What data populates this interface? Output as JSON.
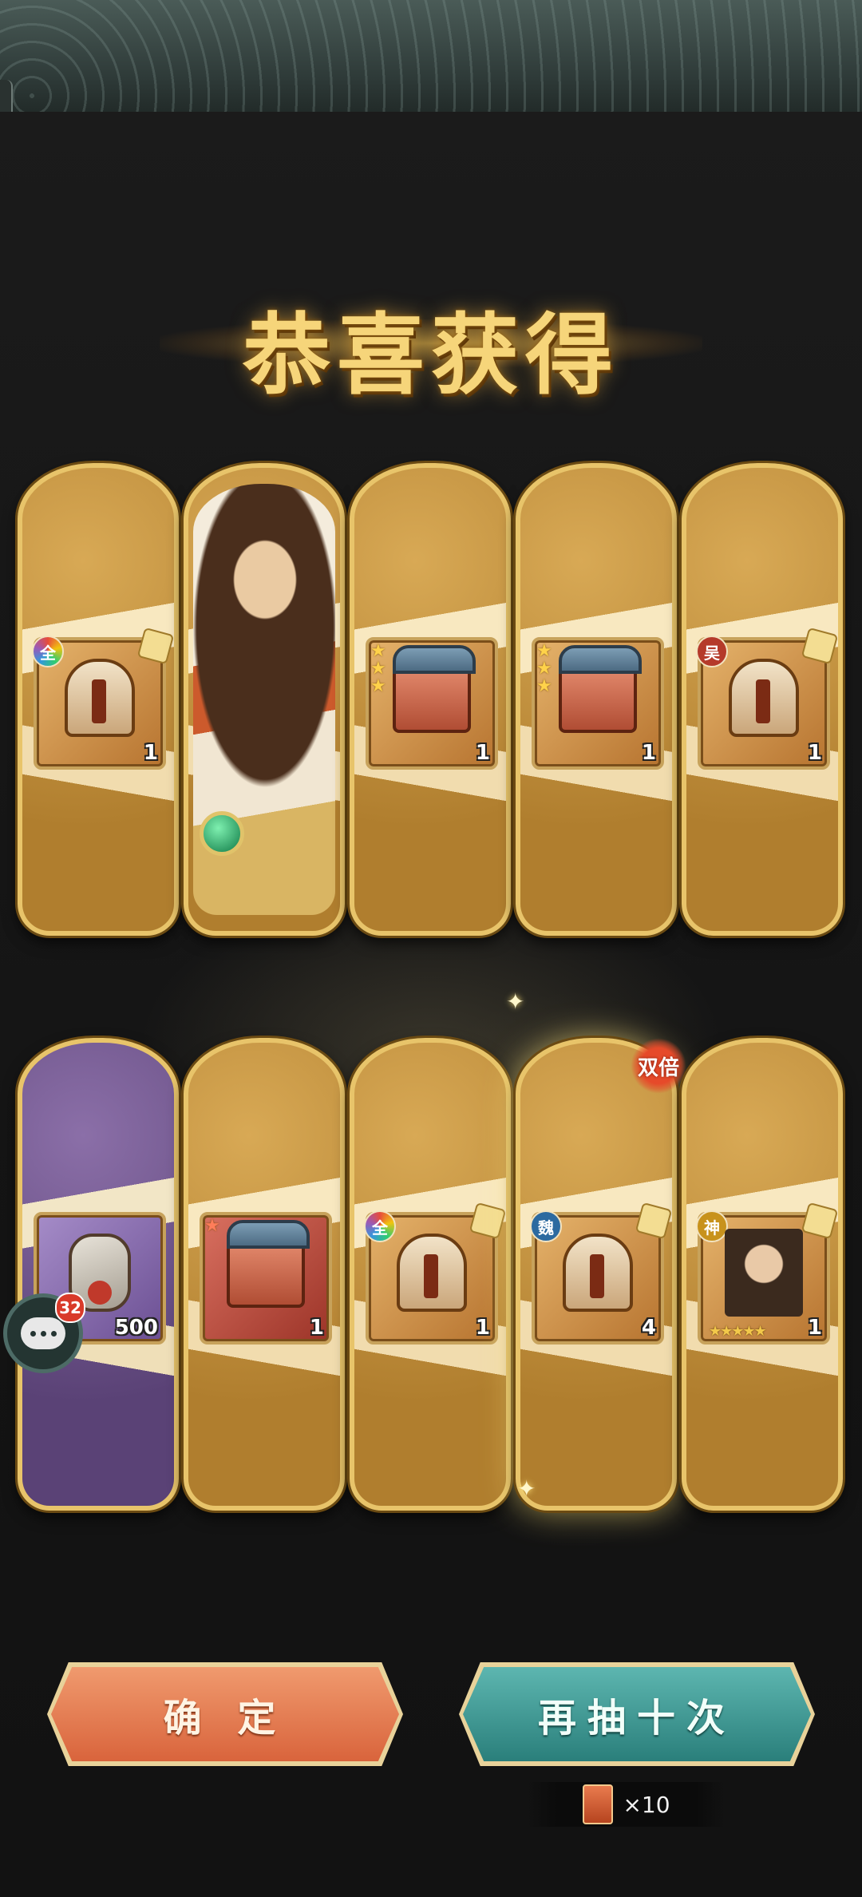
{
  "title": "恭喜获得",
  "cards": [
    {
      "id": "c1",
      "kind": "item",
      "badge": "全",
      "count": "1",
      "icon": "helmet-fragment-icon",
      "rarity": "gold"
    },
    {
      "id": "c2",
      "kind": "hero",
      "icon": "hero-portrait-icon",
      "rarity": "gold"
    },
    {
      "id": "c3",
      "kind": "item",
      "stars": 3,
      "count": "1",
      "icon": "treasure-chest-icon",
      "rarity": "gold"
    },
    {
      "id": "c4",
      "kind": "item",
      "stars": 3,
      "count": "1",
      "icon": "treasure-chest-icon",
      "rarity": "gold"
    },
    {
      "id": "c5",
      "kind": "item",
      "badge": "吴",
      "count": "1",
      "icon": "helmet-fragment-icon",
      "rarity": "gold"
    },
    {
      "id": "c6",
      "kind": "item",
      "count": "500",
      "icon": "jade-pendant-icon",
      "rarity": "purple"
    },
    {
      "id": "c7",
      "kind": "item",
      "stars": 1,
      "count": "1",
      "icon": "treasure-chest-icon",
      "rarity": "gold"
    },
    {
      "id": "c8",
      "kind": "item",
      "badge": "全",
      "count": "1",
      "icon": "helmet-fragment-icon",
      "rarity": "gold"
    },
    {
      "id": "c9",
      "kind": "item",
      "badge": "魏",
      "count": "4",
      "icon": "helmet-fragment-icon",
      "rarity": "gold",
      "tag": "双倍"
    },
    {
      "id": "c10",
      "kind": "item",
      "badge": "神",
      "count": "1",
      "icon": "hero-avatar-icon",
      "rarity": "gold"
    }
  ],
  "chat": {
    "unread": "32"
  },
  "buttons": {
    "confirm": "确 定",
    "draw_again": "再抽十次"
  },
  "cost": {
    "text": "×10"
  },
  "colors": {
    "gold": "#e8c46a",
    "confirm": "#e57a4e",
    "again": "#3b9590",
    "background": "#141414"
  }
}
